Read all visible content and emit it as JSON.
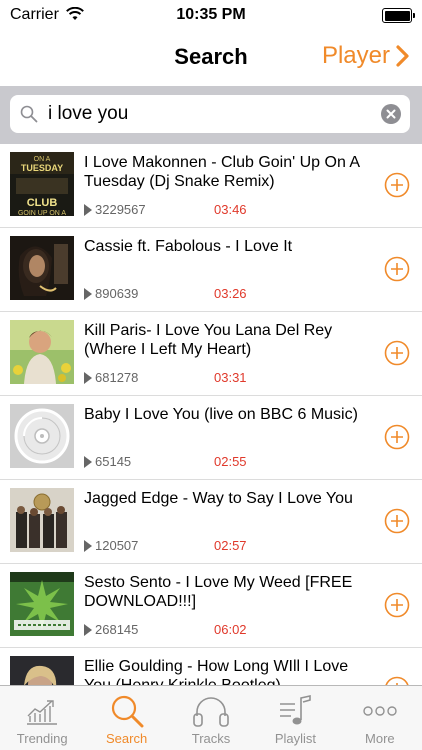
{
  "status_bar": {
    "carrier": "Carrier",
    "time": "10:35 PM"
  },
  "nav": {
    "title": "Search",
    "player_label": "Player"
  },
  "search": {
    "value": "i love you"
  },
  "colors": {
    "accent": "#f08a2a",
    "duration": "#e0392b",
    "search_band": "#c9c9ce"
  },
  "results": [
    {
      "title": "I Love Makonnen - Club Goin' Up On A Tuesday (Dj Snake Remix)",
      "plays": "3229567",
      "duration": "03:46",
      "art": "club-tuesday-cover"
    },
    {
      "title": "Cassie ft. Fabolous -  I Love It",
      "plays": "890639",
      "duration": "03:26",
      "art": "cassie-portrait-cover"
    },
    {
      "title": "Kill Paris- I Love You Lana Del Rey (Where I Left My Heart)",
      "plays": "681278",
      "duration": "03:31",
      "art": "kill-paris-cover"
    },
    {
      "title": "Baby I Love You (live on BBC 6 Music)",
      "plays": "65145",
      "duration": "02:55",
      "art": "default-disc-cover"
    },
    {
      "title": "Jagged Edge - Way to Say I Love You",
      "plays": "120507",
      "duration": "02:57",
      "art": "jagged-edge-cover"
    },
    {
      "title": "Sesto Sento - I Love My Weed [FREE DOWNLOAD!!!]",
      "plays": "268145",
      "duration": "06:02",
      "art": "sesto-sento-cover"
    },
    {
      "title": "Ellie Goulding - How Long WIll I Love You (Henry Krinkle Bootleg)",
      "plays": "",
      "duration": "",
      "art": "ellie-goulding-cover"
    }
  ],
  "tabs": [
    {
      "label": "Trending",
      "icon": "trending-chart-icon"
    },
    {
      "label": "Search",
      "icon": "magnifier-icon",
      "active": true
    },
    {
      "label": "Tracks",
      "icon": "headphones-icon"
    },
    {
      "label": "Playlist",
      "icon": "playlist-note-icon"
    },
    {
      "label": "More",
      "icon": "more-dots-icon"
    }
  ]
}
